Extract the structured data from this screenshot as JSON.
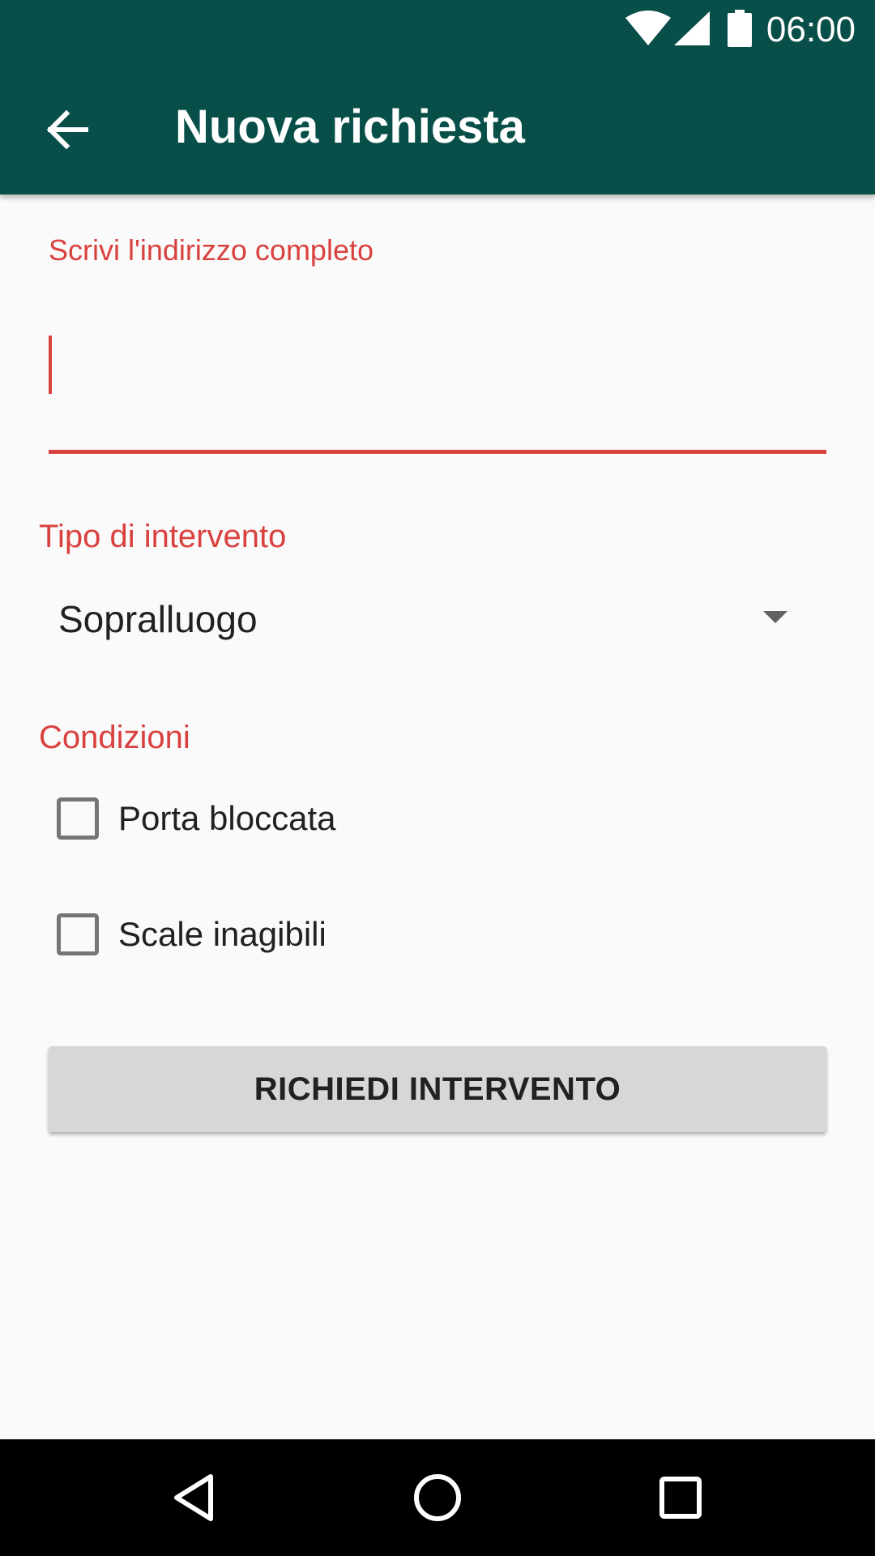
{
  "status_bar": {
    "time": "06:00",
    "battery_level": "100",
    "icons": [
      "wifi-icon",
      "cell-signal-icon",
      "battery-icon"
    ]
  },
  "app_bar": {
    "title": "Nuova richiesta",
    "back_icon": "arrow-left-icon"
  },
  "form": {
    "address": {
      "label": "Scrivi l'indirizzo completo",
      "value": "",
      "placeholder": ""
    },
    "intervention_type": {
      "label": "Tipo di intervento",
      "selected": "Sopralluogo"
    },
    "conditions": {
      "label": "Condizioni",
      "items": [
        {
          "label": "Porta bloccata",
          "checked": false
        },
        {
          "label": "Scale inagibili",
          "checked": false
        }
      ]
    },
    "submit_label": "RICHIEDI INTERVENTO"
  },
  "navigation_bar": {
    "buttons": [
      "back-triangle-icon",
      "home-circle-icon",
      "recents-square-icon"
    ]
  },
  "colors": {
    "primary_dark": "#094F49",
    "accent": "#D9413F",
    "background": "#FAFAFA",
    "button": "#D6D7D7"
  }
}
